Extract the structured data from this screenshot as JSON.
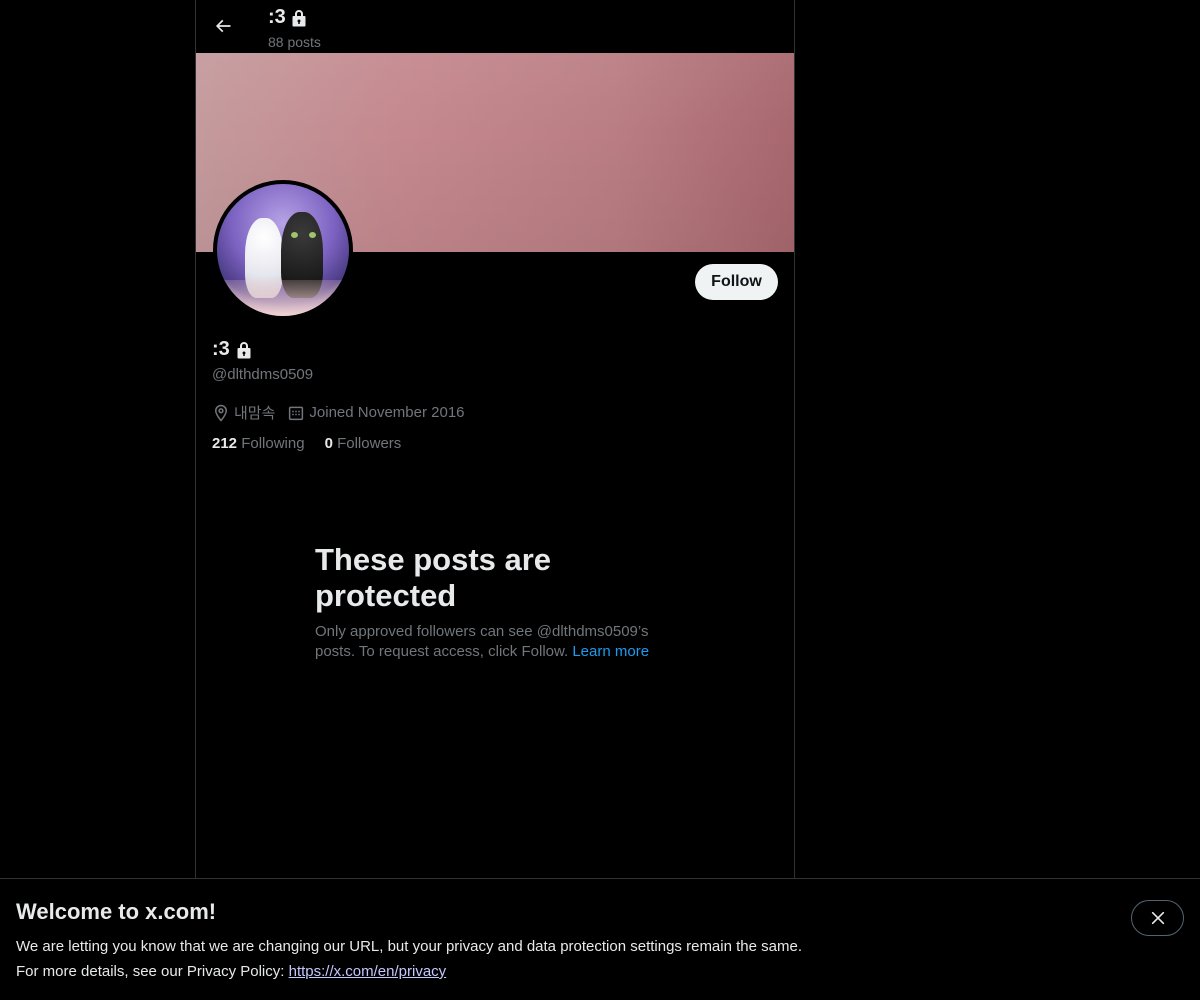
{
  "header": {
    "title": ":3",
    "post_count": "88 posts"
  },
  "profile": {
    "display_name": ":3",
    "handle": "@dlthdms0509",
    "location": "내맘속",
    "joined": "Joined November 2016",
    "following_count": "212",
    "following_label": "Following",
    "followers_count": "0",
    "followers_label": "Followers",
    "follow_button": "Follow"
  },
  "protected": {
    "heading": "These posts are protected",
    "body": "Only approved followers can see @dlthdms0509’s posts. To request access, click Follow.",
    "learn_more": "Learn more"
  },
  "notice": {
    "title": "Welcome to x.com!",
    "line1": "We are letting you know that we are changing our URL, but your privacy and data protection settings remain the same.",
    "line2_prefix": "For more details, see our Privacy Policy:",
    "privacy_link": "https://x.com/en/privacy"
  },
  "icons": {
    "back": "back-arrow-icon",
    "lock": "lock-icon",
    "location": "location-pin-icon",
    "calendar": "calendar-icon",
    "close": "close-icon"
  },
  "colors": {
    "background": "#000000",
    "text_primary": "#e7e9ea",
    "text_secondary": "#71767b",
    "link": "#1d9bf0",
    "border": "#2f3336",
    "follow_button_bg": "#eff3f4"
  }
}
